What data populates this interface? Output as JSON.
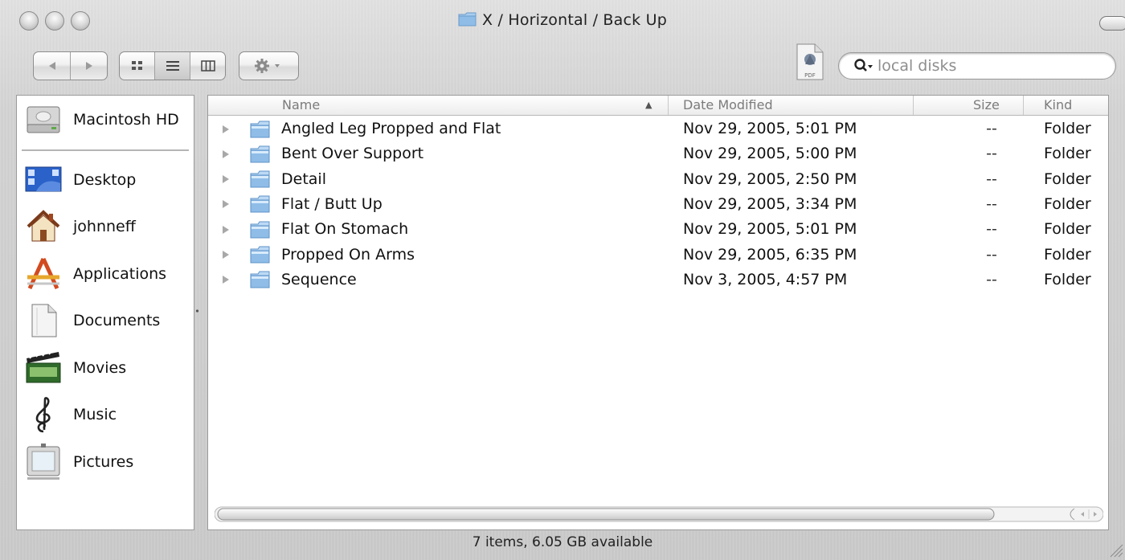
{
  "window": {
    "title": "X / Horizontal / Back Up"
  },
  "toolbar": {
    "back_forward": "back-forward-icon",
    "view_icon": "icon-view-icon",
    "view_list": "list-view-icon",
    "view_column": "column-view-icon",
    "action": "gear-icon",
    "pdf_icon": "pdf-document-icon",
    "search": {
      "value": "local disks",
      "icon": "search-icon"
    }
  },
  "sidebar": {
    "devices": [
      {
        "label": "Macintosh HD",
        "icon": "hard-drive-icon"
      }
    ],
    "places": [
      {
        "label": "Desktop",
        "icon": "desktop-icon"
      },
      {
        "label": "johnneff",
        "icon": "home-icon"
      },
      {
        "label": "Applications",
        "icon": "applications-icon"
      },
      {
        "label": "Documents",
        "icon": "documents-icon"
      },
      {
        "label": "Movies",
        "icon": "movies-icon"
      },
      {
        "label": "Music",
        "icon": "music-icon"
      },
      {
        "label": "Pictures",
        "icon": "pictures-icon"
      }
    ]
  },
  "list": {
    "columns": {
      "name": "Name",
      "date": "Date Modified",
      "size": "Size",
      "kind": "Kind"
    },
    "sort_indicator": "▲",
    "rows": [
      {
        "name": "Angled Leg Propped and Flat",
        "date": "Nov 29, 2005, 5:01 PM",
        "size": "--",
        "kind": "Folder"
      },
      {
        "name": "Bent Over Support",
        "date": "Nov 29, 2005, 5:00 PM",
        "size": "--",
        "kind": "Folder"
      },
      {
        "name": "Detail",
        "date": "Nov 29, 2005, 2:50 PM",
        "size": "--",
        "kind": "Folder"
      },
      {
        "name": "Flat / Butt Up",
        "date": "Nov 29, 2005, 3:34 PM",
        "size": "--",
        "kind": "Folder"
      },
      {
        "name": "Flat On Stomach",
        "date": "Nov 29, 2005, 5:01 PM",
        "size": "--",
        "kind": "Folder"
      },
      {
        "name": "Propped On Arms",
        "date": "Nov 29, 2005, 6:35 PM",
        "size": "--",
        "kind": "Folder"
      },
      {
        "name": "Sequence",
        "date": "Nov 3, 2005, 4:57 PM",
        "size": "--",
        "kind": "Folder"
      }
    ]
  },
  "status": {
    "text": "7 items, 6.05 GB available"
  },
  "colors": {
    "folder_blue": "#7fb4e6",
    "metal": "#cfcfcf",
    "header_text": "#7b7b7b"
  }
}
